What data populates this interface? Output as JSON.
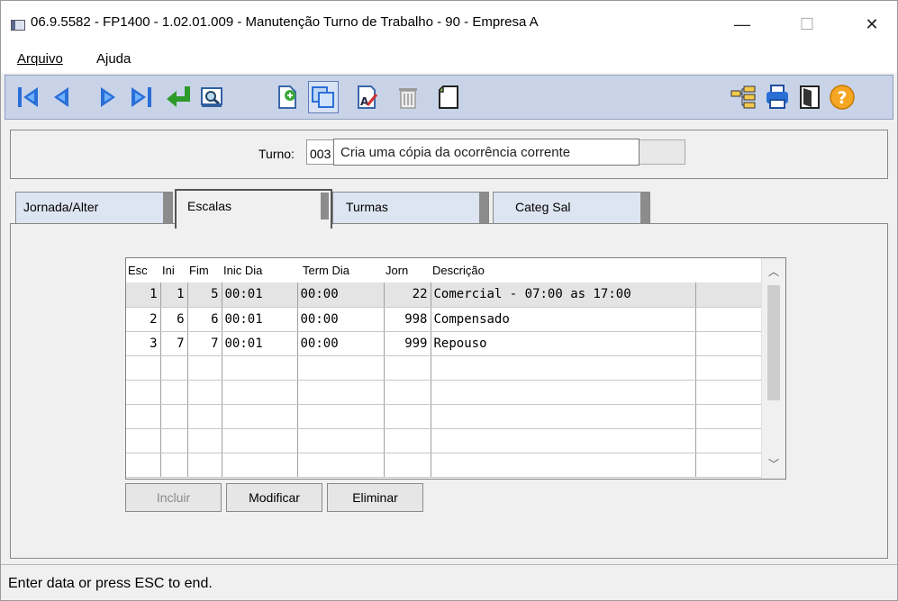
{
  "window": {
    "title": "06.9.5582 - FP1400 - 1.02.01.009 - Manutenção Turno de Trabalho - 90 - Empresa A",
    "minimize": "—",
    "maximize": "☐",
    "close": "✕"
  },
  "menu": {
    "items": [
      {
        "label": "Arquivo"
      },
      {
        "label": "Ajuda"
      }
    ]
  },
  "header": {
    "turno_label": "Turno:",
    "turno_value": "003",
    "turno_desc": ""
  },
  "tooltip": {
    "text": "Cria uma cópia da ocorrência corrente"
  },
  "tabs": [
    {
      "label": "Jornada/Alter"
    },
    {
      "label": "Escalas"
    },
    {
      "label": "Turmas"
    },
    {
      "label": "Categ Sal"
    }
  ],
  "grid": {
    "headers": [
      "Esc",
      "Ini",
      "Fim",
      "Inic Dia",
      "Term Dia",
      "Jorn",
      "Descrição"
    ],
    "rows": [
      [
        "1",
        "1",
        "5",
        "00:01",
        "00:00",
        "22",
        "Comercial - 07:00 as 17:00"
      ],
      [
        "2",
        "6",
        "6",
        "00:01",
        "00:00",
        "998",
        "Compensado"
      ],
      [
        "3",
        "7",
        "7",
        "00:01",
        "00:00",
        "999",
        "Repouso"
      ]
    ]
  },
  "buttons": {
    "incluir": "Incluir",
    "modificar": "Modificar",
    "eliminar": "Eliminar"
  },
  "status": {
    "text": "Enter data or press ESC to end."
  }
}
